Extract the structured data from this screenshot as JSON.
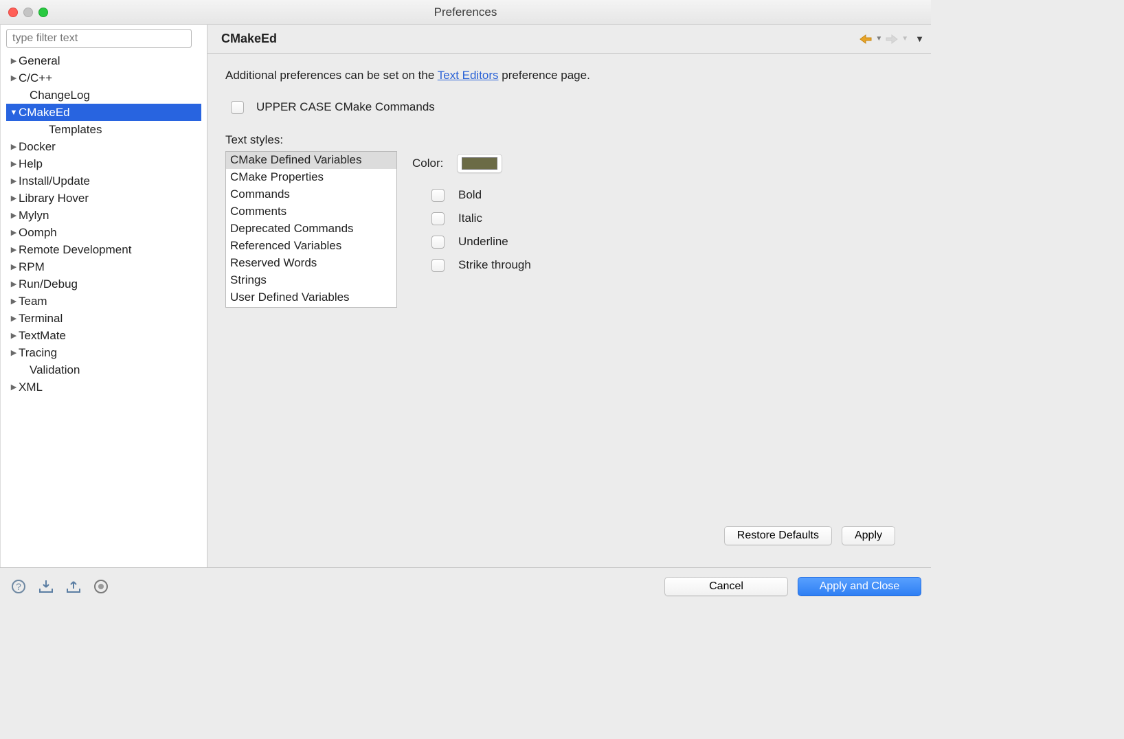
{
  "window": {
    "title": "Preferences"
  },
  "sidebar": {
    "filter_placeholder": "type filter text",
    "items": [
      {
        "label": "General",
        "arrow": "right",
        "indent": 0,
        "selected": false
      },
      {
        "label": "C/C++",
        "arrow": "right",
        "indent": 0,
        "selected": false
      },
      {
        "label": "ChangeLog",
        "arrow": "",
        "indent": 1,
        "selected": false
      },
      {
        "label": "CMakeEd",
        "arrow": "down",
        "indent": 0,
        "selected": true
      },
      {
        "label": "Templates",
        "arrow": "",
        "indent": 2,
        "selected": false
      },
      {
        "label": "Docker",
        "arrow": "right",
        "indent": 0,
        "selected": false
      },
      {
        "label": "Help",
        "arrow": "right",
        "indent": 0,
        "selected": false
      },
      {
        "label": "Install/Update",
        "arrow": "right",
        "indent": 0,
        "selected": false
      },
      {
        "label": "Library Hover",
        "arrow": "right",
        "indent": 0,
        "selected": false
      },
      {
        "label": "Mylyn",
        "arrow": "right",
        "indent": 0,
        "selected": false
      },
      {
        "label": "Oomph",
        "arrow": "right",
        "indent": 0,
        "selected": false
      },
      {
        "label": "Remote Development",
        "arrow": "right",
        "indent": 0,
        "selected": false
      },
      {
        "label": "RPM",
        "arrow": "right",
        "indent": 0,
        "selected": false
      },
      {
        "label": "Run/Debug",
        "arrow": "right",
        "indent": 0,
        "selected": false
      },
      {
        "label": "Team",
        "arrow": "right",
        "indent": 0,
        "selected": false
      },
      {
        "label": "Terminal",
        "arrow": "right",
        "indent": 0,
        "selected": false
      },
      {
        "label": "TextMate",
        "arrow": "right",
        "indent": 0,
        "selected": false
      },
      {
        "label": "Tracing",
        "arrow": "right",
        "indent": 0,
        "selected": false
      },
      {
        "label": "Validation",
        "arrow": "",
        "indent": 1,
        "selected": false
      },
      {
        "label": "XML",
        "arrow": "right",
        "indent": 0,
        "selected": false
      }
    ]
  },
  "page": {
    "title": "CMakeEd",
    "intro_prefix": "Additional preferences can be set on the ",
    "intro_link": "Text Editors",
    "intro_suffix": " preference page.",
    "uppercase_label": "UPPER CASE CMake Commands",
    "uppercase_checked": false,
    "text_styles_label": "Text styles:",
    "styles": [
      "CMake Defined Variables",
      "CMake Properties",
      "Commands",
      "Comments",
      "Deprecated Commands",
      "Referenced Variables",
      "Reserved Words",
      "Strings",
      "User Defined Variables"
    ],
    "selected_style_index": 0,
    "color_label": "Color:",
    "color_value": "#6b6b46",
    "format_options": {
      "bold": {
        "label": "Bold",
        "checked": false
      },
      "italic": {
        "label": "Italic",
        "checked": false
      },
      "underline": {
        "label": "Underline",
        "checked": false
      },
      "strikethrough": {
        "label": "Strike through",
        "checked": false
      }
    },
    "restore_label": "Restore Defaults",
    "apply_label": "Apply"
  },
  "footer": {
    "cancel_label": "Cancel",
    "apply_close_label": "Apply and Close"
  }
}
